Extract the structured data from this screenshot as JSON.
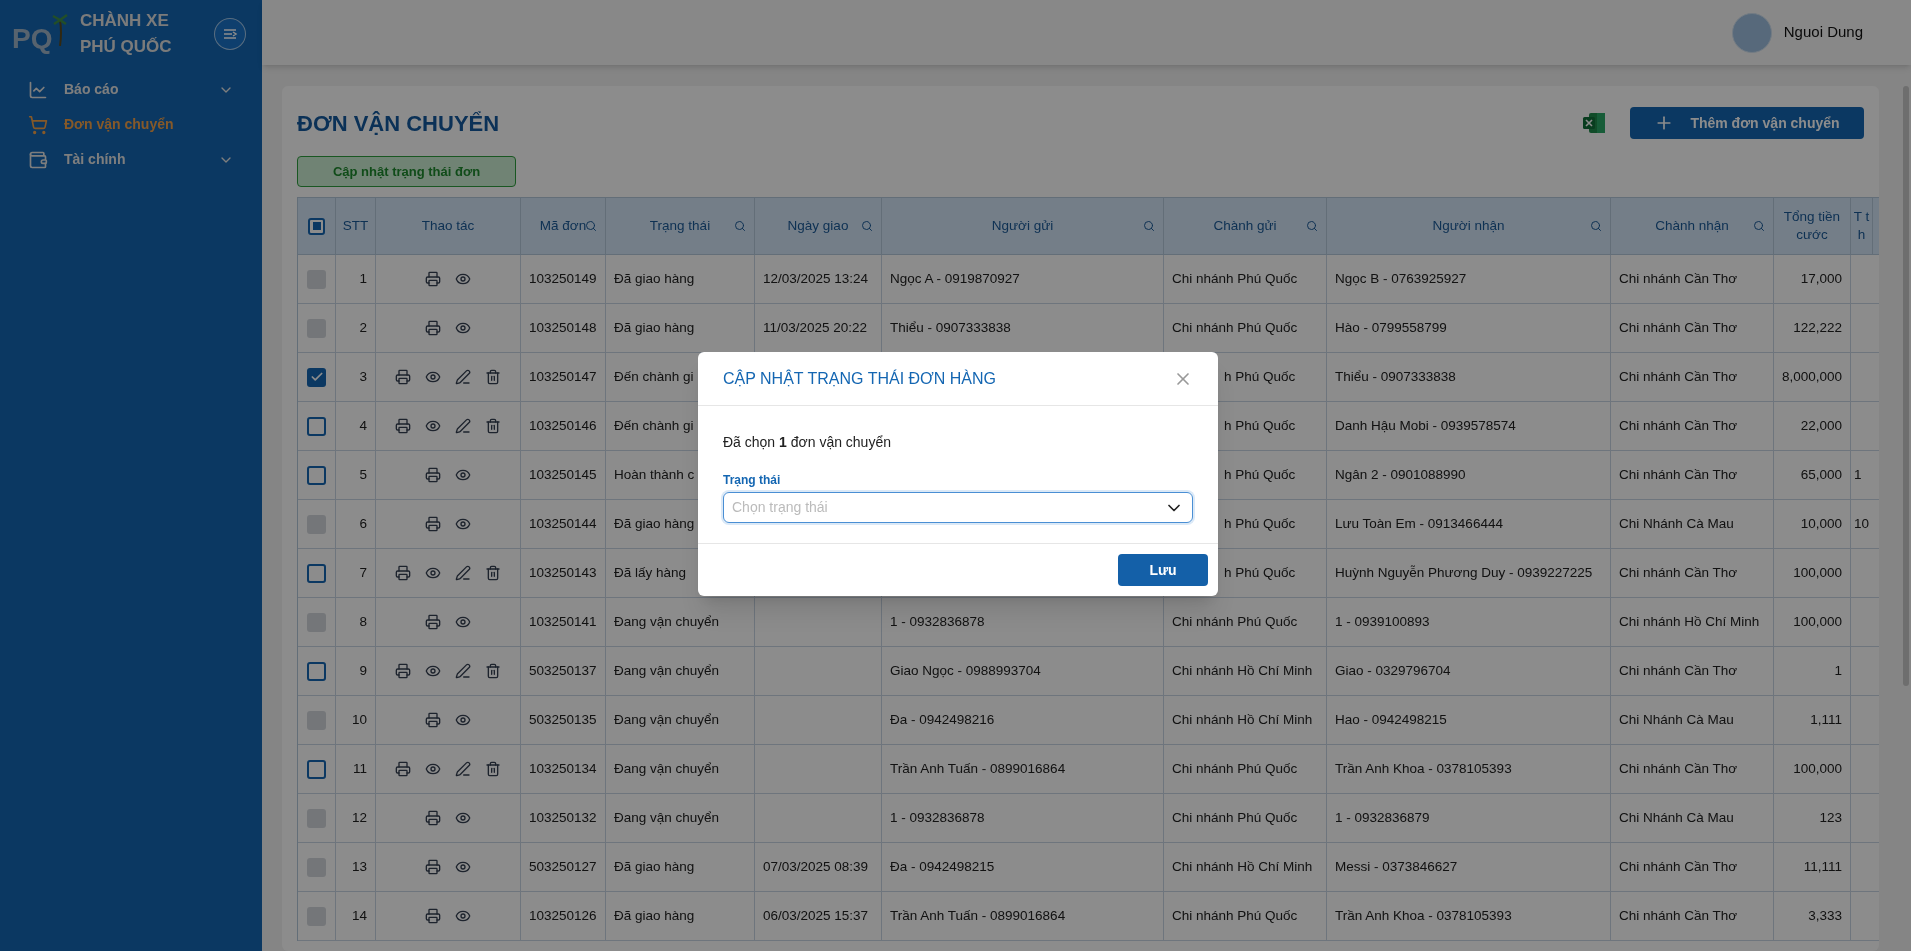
{
  "sidebar": {
    "logo_text": "PQ",
    "brand": [
      "CHÀNH XE",
      "PHÚ QUỐC"
    ],
    "items": [
      {
        "label": "Báo cáo",
        "kind": "chart",
        "selected": false,
        "expandable": true
      },
      {
        "label": "Đơn vận chuyển",
        "kind": "cart",
        "selected": true,
        "expandable": false
      },
      {
        "label": "Tài chính",
        "kind": "wallet",
        "selected": false,
        "expandable": true
      }
    ]
  },
  "header": {
    "user": "Nguoi Dung"
  },
  "page": {
    "title": "ĐƠN VẬN CHUYỂN",
    "add_button": "Thêm đơn vận chuyển",
    "bulk_button": "Cập nhật trạng thái đơn"
  },
  "table": {
    "header_checkbox": {
      "indeterminate": true
    },
    "columns": [
      {
        "label": "STT",
        "searchable": false
      },
      {
        "label": "Thao tác",
        "searchable": false
      },
      {
        "label": "Mã đơn",
        "searchable": true
      },
      {
        "label": "Trạng thái",
        "searchable": true
      },
      {
        "label": "Ngày giao",
        "searchable": true
      },
      {
        "label": "Người gửi",
        "searchable": true
      },
      {
        "label": "Chành gửi",
        "searchable": true
      },
      {
        "label": "Người nhận",
        "searchable": true
      },
      {
        "label": "Chành nhận",
        "searchable": true
      },
      {
        "label": "Tổng tiền cước",
        "searchable": false
      },
      {
        "label": "T th",
        "searchable": false
      }
    ],
    "rows": [
      {
        "stt": "1",
        "disabled": true,
        "checked": false,
        "actions": [
          {
            "kind": "print"
          },
          {
            "kind": "view"
          }
        ],
        "code": "103250149",
        "status": "Đã giao hàng",
        "date": "12/03/2025 13:24",
        "sender": "Ngọc A - 0919870927",
        "from_branch": "Chi nhánh Phú Quốc",
        "partly_hidden": false,
        "receiver": "Ngọc B - 0763925927",
        "to_branch": "Chi nhánh Cần Thơ",
        "total": "17,000"
      },
      {
        "stt": "2",
        "disabled": true,
        "checked": false,
        "actions": [
          {
            "kind": "print"
          },
          {
            "kind": "view"
          }
        ],
        "code": "103250148",
        "status": "Đã giao hàng",
        "date": "11/03/2025 20:22",
        "sender": "Thiểu - 0907333838",
        "from_branch": "Chi nhánh Phú Quốc",
        "partly_hidden": false,
        "receiver": "Hào - 0799558799",
        "to_branch": "Chi nhánh Cần Thơ",
        "total": "122,222"
      },
      {
        "stt": "3",
        "disabled": false,
        "checked": true,
        "actions": [
          {
            "kind": "print"
          },
          {
            "kind": "view"
          },
          {
            "kind": "edit"
          },
          {
            "kind": "delete"
          }
        ],
        "code": "103250147",
        "status": "Đến chành gi",
        "from_branch": "h Phú Quốc",
        "partly_hidden": true,
        "receiver": "Thiểu - 0907333838",
        "to_branch": "Chi nhánh Cần Thơ",
        "total": "8,000,000"
      },
      {
        "stt": "4",
        "disabled": false,
        "checked": false,
        "actions": [
          {
            "kind": "print"
          },
          {
            "kind": "view"
          },
          {
            "kind": "edit"
          },
          {
            "kind": "delete"
          }
        ],
        "code": "103250146",
        "status": "Đến chành gi",
        "from_branch": "h Phú Quốc",
        "partly_hidden": true,
        "receiver": "Danh Hậu Mobi - 0939578574",
        "to_branch": "Chi nhánh Cần Thơ",
        "total": "22,000"
      },
      {
        "stt": "5",
        "disabled": false,
        "checked": false,
        "actions": [
          {
            "kind": "print"
          },
          {
            "kind": "view"
          }
        ],
        "code": "103250145",
        "status": "Hoàn thành c",
        "from_branch": "h Phú Quốc",
        "partly_hidden": true,
        "receiver": "Ngân 2 - 0901088990",
        "to_branch": "Chi nhánh Cần Thơ",
        "total": "65,000",
        "column_11": "1"
      },
      {
        "stt": "6",
        "disabled": true,
        "checked": false,
        "actions": [
          {
            "kind": "print"
          },
          {
            "kind": "view"
          }
        ],
        "code": "103250144",
        "status": "Đã giao hàng",
        "from_branch": "h Phú Quốc",
        "partly_hidden": true,
        "receiver": "Lưu Toàn Em - 0913466444",
        "to_branch": "Chi Nhánh Cà Mau",
        "total": "10,000",
        "column_11": "10"
      },
      {
        "stt": "7",
        "disabled": false,
        "checked": false,
        "actions": [
          {
            "kind": "print"
          },
          {
            "kind": "view"
          },
          {
            "kind": "edit"
          },
          {
            "kind": "delete"
          }
        ],
        "code": "103250143",
        "status": "Đã lấy hàng",
        "from_branch": "h Phú Quốc",
        "partly_hidden": true,
        "receiver": "Huỳnh Nguyễn Phương Duy - 0939227225",
        "to_branch": "Chi nhánh Cần Thơ",
        "total": "100,000"
      },
      {
        "stt": "8",
        "disabled": true,
        "checked": false,
        "actions": [
          {
            "kind": "print"
          },
          {
            "kind": "view"
          }
        ],
        "code": "103250141",
        "status": "Đang vận chuyển",
        "sender": "1 - 0932836878",
        "from_branch": "Chi nhánh Phú Quốc",
        "partly_hidden": false,
        "receiver": "1 - 0939100893",
        "to_branch": "Chi nhánh Hồ Chí Minh",
        "total": "100,000"
      },
      {
        "stt": "9",
        "disabled": false,
        "checked": false,
        "actions": [
          {
            "kind": "print"
          },
          {
            "kind": "view"
          },
          {
            "kind": "edit"
          },
          {
            "kind": "delete"
          }
        ],
        "code": "503250137",
        "status": "Đang vận chuyển",
        "sender": "Giao Ngọc - 0988993704",
        "from_branch": "Chi nhánh Hồ Chí Minh",
        "partly_hidden": false,
        "receiver": "Giao - 0329796704",
        "to_branch": "Chi nhánh Cần Thơ",
        "total": "1"
      },
      {
        "stt": "10",
        "disabled": true,
        "checked": false,
        "actions": [
          {
            "kind": "print"
          },
          {
            "kind": "view"
          }
        ],
        "code": "503250135",
        "status": "Đang vận chuyển",
        "sender": "Đa - 0942498216",
        "from_branch": "Chi nhánh Hồ Chí Minh",
        "partly_hidden": false,
        "receiver": "Hao - 0942498215",
        "to_branch": "Chi Nhánh Cà Mau",
        "total": "1,111"
      },
      {
        "stt": "11",
        "disabled": false,
        "checked": false,
        "actions": [
          {
            "kind": "print"
          },
          {
            "kind": "view"
          },
          {
            "kind": "edit"
          },
          {
            "kind": "delete"
          }
        ],
        "code": "103250134",
        "status": "Đang vận chuyển",
        "sender": "Trần Anh Tuấn - 0899016864",
        "from_branch": "Chi nhánh Phú Quốc",
        "partly_hidden": false,
        "receiver": "Trần Anh Khoa - 0378105393",
        "to_branch": "Chi nhánh Cần Thơ",
        "total": "100,000"
      },
      {
        "stt": "12",
        "disabled": true,
        "checked": false,
        "actions": [
          {
            "kind": "print"
          },
          {
            "kind": "view"
          }
        ],
        "code": "103250132",
        "status": "Đang vận chuyển",
        "sender": "1 - 0932836878",
        "from_branch": "Chi nhánh Phú Quốc",
        "partly_hidden": false,
        "receiver": "1 - 0932836879",
        "to_branch": "Chi Nhánh Cà Mau",
        "total": "123"
      },
      {
        "stt": "13",
        "disabled": true,
        "checked": false,
        "actions": [
          {
            "kind": "print"
          },
          {
            "kind": "view"
          }
        ],
        "code": "503250127",
        "status": "Đã giao hàng",
        "date": "07/03/2025 08:39",
        "sender": "Đa - 0942498215",
        "from_branch": "Chi nhánh Hồ Chí Minh",
        "partly_hidden": false,
        "receiver": "Messi - 0373846627",
        "to_branch": "Chi nhánh Cần Thơ",
        "total": "11,111"
      },
      {
        "stt": "14",
        "disabled": true,
        "checked": false,
        "actions": [
          {
            "kind": "print"
          },
          {
            "kind": "view"
          }
        ],
        "code": "103250126",
        "status": "Đã giao hàng",
        "date": "06/03/2025 15:37",
        "sender": "Trần Anh Tuấn - 0899016864",
        "from_branch": "Chi nhánh Phú Quốc",
        "partly_hidden": false,
        "receiver": "Trần Anh Khoa - 0378105393",
        "to_branch": "Chi nhánh Cần Thơ",
        "total": "3,333"
      }
    ]
  },
  "dialog": {
    "title": "CẬP NHẬT TRẠNG THÁI ĐƠN HÀNG",
    "summary": "Đã chọn **1** đơn vận chuyển",
    "field_label": "Trạng thái",
    "placeholder": "Chọn trạng thái",
    "save_button": "Lưu"
  }
}
